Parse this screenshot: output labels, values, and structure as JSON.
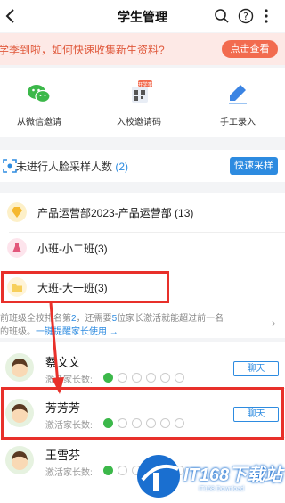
{
  "header": {
    "title": "学生管理"
  },
  "promo": {
    "text": "开学季到啦，如何快速收集新生资料?",
    "button": "点击查看"
  },
  "actions": [
    {
      "label": "从微信邀请",
      "icon": "wechat-icon"
    },
    {
      "label": "入校邀请码",
      "icon": "qrcode-icon",
      "badge": "开学季"
    },
    {
      "label": "手工录入",
      "icon": "pen-icon"
    }
  ],
  "face": {
    "label": "未进行人脸采样人数",
    "count": "(2)",
    "button": "快速采样"
  },
  "classes": [
    {
      "label": "产品运营部2023-产品运营部 (13)",
      "icon": "diamond-icon"
    },
    {
      "label": "小班-小二班(3)",
      "icon": "flask-icon"
    },
    {
      "label": "大班-大一班(3)",
      "icon": "folder-icon"
    }
  ],
  "tip": {
    "line1_pre": "前班级全校排名第",
    "rank": "2",
    "line1_mid": "，还需要",
    "needed": "5",
    "line1_post": "位家长激活就能超过前一名",
    "line2_pre": "的班级。",
    "link": "一键提醒家长使用 →"
  },
  "students": [
    {
      "name": "蔡文文",
      "activate_label": "激活家长数:",
      "active": 1,
      "total": 6,
      "chat": "聊天"
    },
    {
      "name": "芳芳芳",
      "activate_label": "激活家长数:",
      "active": 1,
      "total": 6,
      "chat": "聊天"
    },
    {
      "name": "王雪芬",
      "activate_label": "激活家长数:",
      "active": 1,
      "total": 6,
      "chat": "聊天"
    }
  ],
  "watermark": {
    "title": "IT168下载站",
    "subtitle": "IT168 Download"
  },
  "colors": {
    "accent": "#2d8be0",
    "promo": "#f26b4f",
    "highlight": "#e8302a",
    "active": "#3cb84a"
  }
}
